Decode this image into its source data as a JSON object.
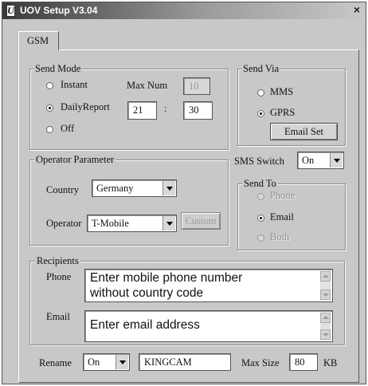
{
  "window": {
    "title": "UOV Setup V3.04",
    "close": "×"
  },
  "tabs": [
    {
      "label": "GSM"
    }
  ],
  "send_mode": {
    "title": "Send Mode",
    "options": [
      "Instant",
      "DailyReport",
      "Off"
    ],
    "selected": "DailyReport",
    "max_num_label": "Max Num",
    "max_num_value": "10",
    "hour": "21",
    "separator": ":",
    "minute": "30"
  },
  "send_via": {
    "title": "Send Via",
    "options": [
      "MMS",
      "GPRS"
    ],
    "selected": "GPRS",
    "email_set_button": "Email Set"
  },
  "operator": {
    "title": "Operator Parameter",
    "country_label": "Country",
    "country_value": "Germany",
    "operator_label": "Operator",
    "operator_value": "T-Mobile",
    "custom_button": "Custom"
  },
  "sms_switch": {
    "label": "SMS Switch",
    "value": "On"
  },
  "send_to": {
    "title": "Send To",
    "options": [
      "Phone",
      "Email",
      "Both"
    ],
    "selected": "Email"
  },
  "recipients": {
    "title": "Recipients",
    "phone_label": "Phone",
    "phone_line1": "Enter mobile phone number",
    "phone_line2": "without country code",
    "email_label": "Email",
    "email_text": "Enter email address"
  },
  "footer": {
    "rename_label": "Rename",
    "rename_value": "On",
    "name_value": "KINGCAM",
    "max_size_label": "Max Size",
    "max_size_value": "80",
    "unit": "KB"
  }
}
